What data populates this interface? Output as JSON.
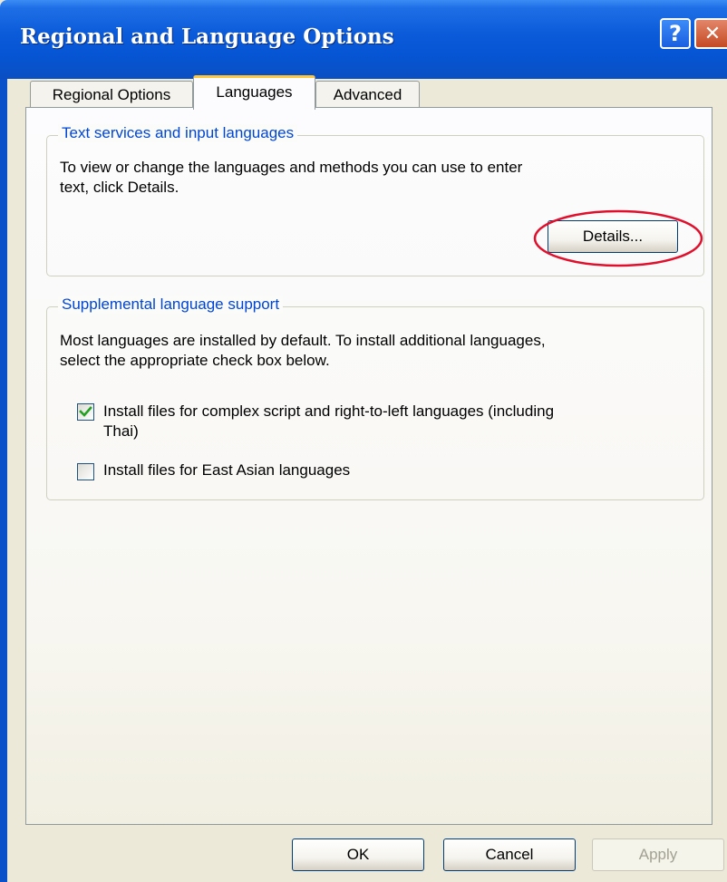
{
  "window": {
    "title": "Regional and Language Options",
    "help_glyph": "?",
    "close_glyph": "✕"
  },
  "tabs": [
    {
      "label": "Regional Options",
      "selected": false
    },
    {
      "label": "Languages",
      "selected": true
    },
    {
      "label": "Advanced",
      "selected": false
    }
  ],
  "text_services": {
    "legend": "Text services and input languages",
    "description_line1": "To view or change the languages and methods you can use to enter",
    "description_line2": "text, click Details.",
    "details_button": "Details..."
  },
  "supplemental": {
    "legend": "Supplemental language support",
    "description_line1": "Most languages are installed by default. To install additional languages,",
    "description_line2": "select the appropriate check box below.",
    "options": [
      {
        "label_line1": "Install files for complex script and right-to-left languages (including",
        "label_line2": "Thai)",
        "checked": true
      },
      {
        "label_line1": "Install files for East Asian languages",
        "label_line2": "",
        "checked": false
      }
    ]
  },
  "footer": {
    "ok": "OK",
    "cancel": "Cancel",
    "apply": "Apply"
  },
  "colors": {
    "legend_blue": "#0046d5",
    "highlight_ring": "#e0102c",
    "check_green": "#21a121"
  }
}
